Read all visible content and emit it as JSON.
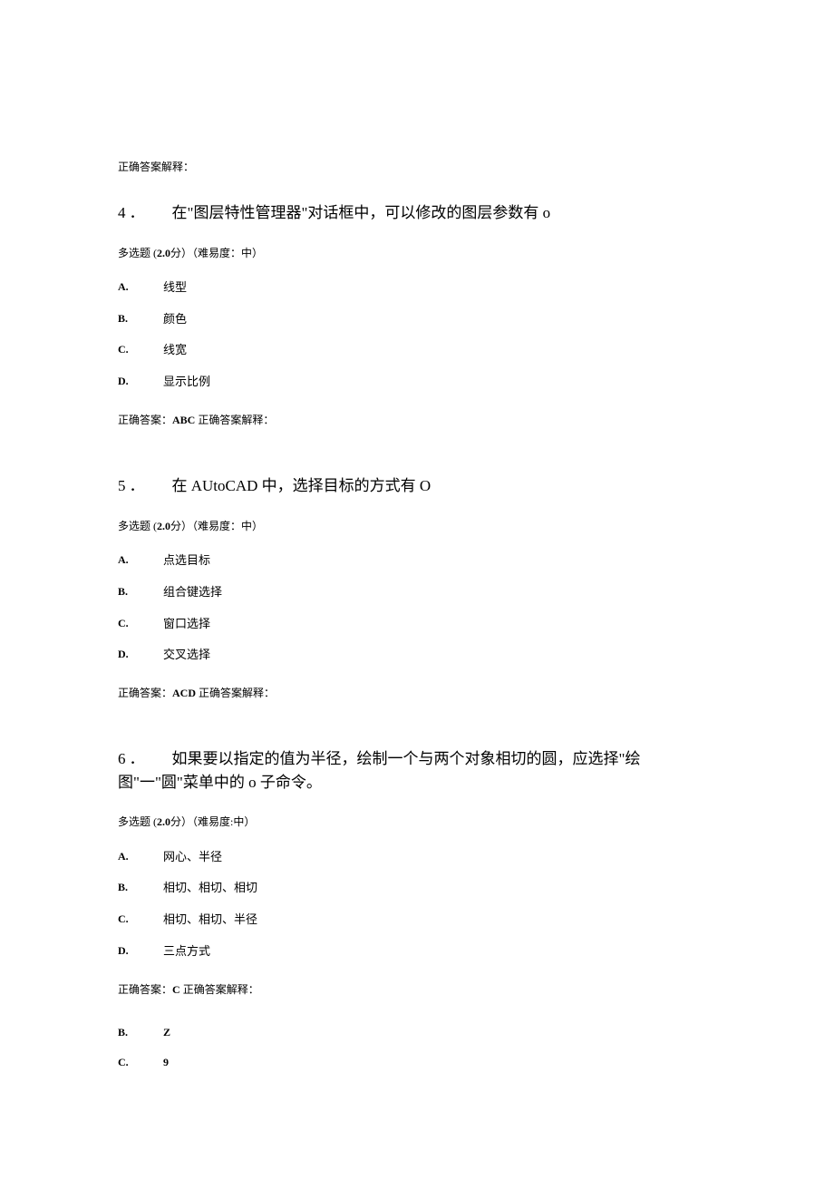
{
  "pre_expl": "正确答案解释：",
  "questions": [
    {
      "num": "4．",
      "title": "在\"图层特性管理器\"对话框中，可以修改的图层参数有 o",
      "meta_prefix": "多选题 (",
      "meta_score": "2.0",
      "meta_score_suffix": "分）（难易度：中）",
      "options": [
        {
          "letter": "A.",
          "text": "线型"
        },
        {
          "letter": "B.",
          "text": "颜色"
        },
        {
          "letter": "C.",
          "text": "线宽"
        },
        {
          "letter": "D.",
          "text": "显示比例"
        }
      ],
      "ans_prefix": "正确答案：",
      "ans_val": "ABC",
      "ans_suffix": " 正确答案解释："
    },
    {
      "num": "5．",
      "title": "在 AUtoCAD 中，选择目标的方式有 O",
      "meta_prefix": "多选题 (",
      "meta_score": "2.0",
      "meta_score_suffix": "分）（难易度：中）",
      "options": [
        {
          "letter": "A.",
          "text": "点选目标"
        },
        {
          "letter": "B.",
          "text": "组合键选择"
        },
        {
          "letter": "C.",
          "text": "窗口选择"
        },
        {
          "letter": "D.",
          "text": "交叉选择"
        }
      ],
      "ans_prefix": "正确答案：",
      "ans_val": "ACD",
      "ans_suffix": " 正确答案解释："
    },
    {
      "num": "6．",
      "title": "如果要以指定的值为半径，绘制一个与两个对象相切的圆，应选择\"绘图\"一\"圆\"菜单中的 o 子命令。",
      "meta_prefix": "多选题 (",
      "meta_score": "2.0",
      "meta_score_suffix": "分）（难易度:中）",
      "options": [
        {
          "letter": "A.",
          "text": "网心、半径"
        },
        {
          "letter": "B.",
          "text": "相切、相切、相切"
        },
        {
          "letter": "C.",
          "text": "相切、相切、半径"
        },
        {
          "letter": "D.",
          "text": "三点方式"
        }
      ],
      "ans_prefix": "正确答案：",
      "ans_val": "C",
      "ans_suffix": " 正确答案解释："
    }
  ],
  "tail": [
    {
      "letter": "B.",
      "text": "Z"
    },
    {
      "letter": "C.",
      "text": "9"
    }
  ]
}
